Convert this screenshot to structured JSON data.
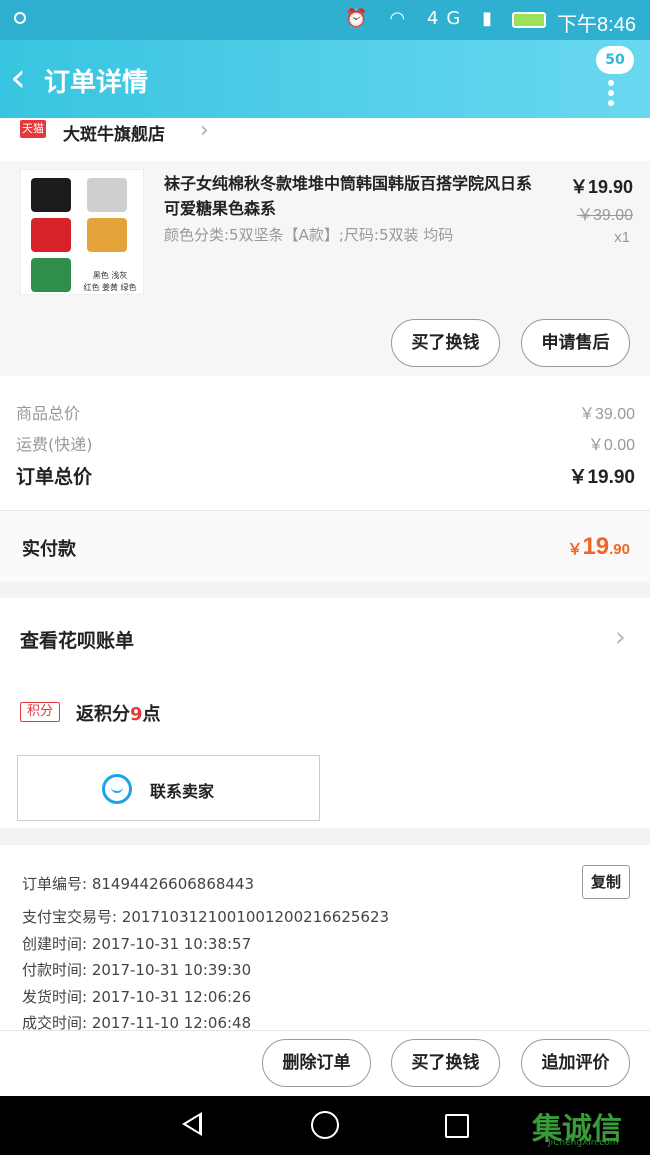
{
  "status": {
    "time": "下午8:46",
    "network": "4G"
  },
  "header": {
    "back_icon": "‹",
    "title": "订单详情",
    "badge": "50"
  },
  "shop": {
    "platform_badge": "天猫",
    "name": "大斑牛旗舰店"
  },
  "product": {
    "title": "袜子女纯棉秋冬款堆堆中筒韩国韩版百搭学院风日系可爱糖果色森系",
    "spec": "颜色分类:5双坚条【A款】;尺码:5双装 均码",
    "price": "￥19.90",
    "old_price": "￥39.00",
    "qty": "x1",
    "thumb_caption_1": "黑色 浅灰",
    "thumb_caption_2": "红色 姜黄 绿色",
    "btn_buy_insurance": "买了换钱",
    "btn_after_sale": "申请售后"
  },
  "sums": {
    "goods_label": "商品总价",
    "goods_value": "￥39.00",
    "shipping_label": "运费(快递)",
    "shipping_value": "￥0.00",
    "total_label": "订单总价",
    "total_value": "￥19.90"
  },
  "paid": {
    "label": "实付款",
    "currency": "￥",
    "int": "19",
    "dec": ".90"
  },
  "huabei": {
    "title": "查看花呗账单",
    "points_tag": "积分",
    "points_prefix": "返积分",
    "points_num": "9",
    "points_suffix": "点",
    "contact_label": "联系卖家"
  },
  "order_info": {
    "order_no": "订单编号: 81494426606868443",
    "alipay_no": "支付宝交易号: 2017103121001001200216625623",
    "created": "创建时间: 2017-10-31 10:38:57",
    "paid": "付款时间: 2017-10-31 10:39:30",
    "shipped": "发货时间: 2017-10-31 12:06:26",
    "completed": "成交时间: 2017-11-10 12:06:48",
    "copy_label": "复制"
  },
  "actions": {
    "delete": "删除订单",
    "buy_insurance": "买了换钱",
    "add_review": "追加评价"
  },
  "watermark": {
    "main": "集诚信",
    "sub": "JiChengXin.com"
  }
}
